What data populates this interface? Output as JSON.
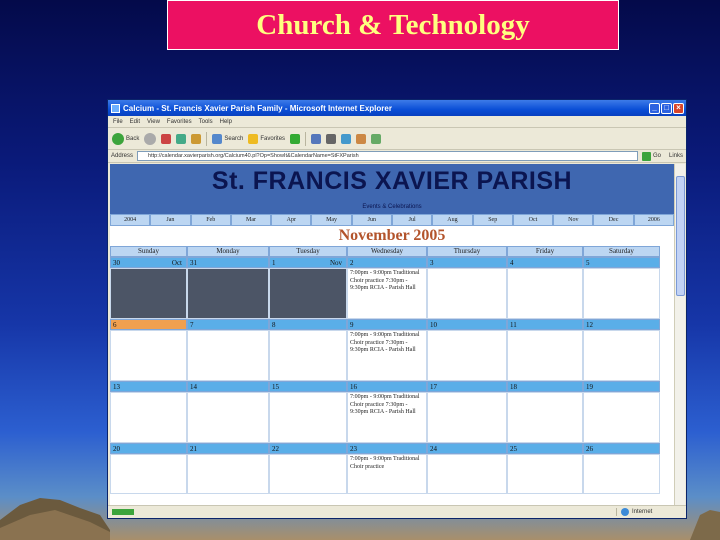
{
  "slide": {
    "title": "Church & Technology"
  },
  "window": {
    "title": "Calcium - St. Francis Xavier Parish Family - Microsoft Internet Explorer",
    "menu": [
      "File",
      "Edit",
      "View",
      "Favorites",
      "Tools",
      "Help"
    ],
    "toolbar": {
      "back": "Back",
      "search": "Search",
      "favorites": "Favorites"
    },
    "address": {
      "label": "Address",
      "url": "http://calendar.xavierparish.org/Calcium40.pl?Op=ShowIt&CalendarName=StFXParish",
      "go": "Go",
      "links": "Links"
    },
    "status": {
      "zone": "Internet"
    }
  },
  "calendar": {
    "parish": "St. FRANCIS XAVIER PARISH",
    "subtitle": "Events & Celebrations",
    "months": [
      "2004",
      "Jan",
      "Feb",
      "Mar",
      "Apr",
      "May",
      "Jun",
      "Jul",
      "Aug",
      "Sep",
      "Oct",
      "Nov",
      "Dec",
      "2006"
    ],
    "month_title": "November 2005",
    "weekdays": [
      "Sunday",
      "Monday",
      "Tuesday",
      "Wednesday",
      "Thursday",
      "Friday",
      "Saturday"
    ],
    "weeks": [
      {
        "days": [
          {
            "n": "30",
            "tag": "Oct"
          },
          {
            "n": "31",
            "tag": ""
          },
          {
            "n": "1",
            "tag": "Nov"
          },
          {
            "n": "2",
            "tag": ""
          },
          {
            "n": "3",
            "tag": ""
          },
          {
            "n": "4",
            "tag": ""
          },
          {
            "n": "5",
            "tag": ""
          }
        ],
        "events": [
          "",
          "",
          "",
          "7:00pm - 9:00pm Traditional Choir practice 7:30pm - 9:30pm RCIA - Parish Hall",
          "",
          "",
          ""
        ]
      },
      {
        "days": [
          {
            "n": "6",
            "tag": ""
          },
          {
            "n": "7",
            "tag": ""
          },
          {
            "n": "8",
            "tag": ""
          },
          {
            "n": "9",
            "tag": ""
          },
          {
            "n": "10",
            "tag": ""
          },
          {
            "n": "11",
            "tag": ""
          },
          {
            "n": "12",
            "tag": ""
          }
        ],
        "events": [
          "",
          "",
          "",
          "7:00pm - 9:00pm Traditional Choir practice 7:30pm - 9:30pm RCIA - Parish Hall",
          "",
          "",
          ""
        ]
      },
      {
        "days": [
          {
            "n": "13",
            "tag": ""
          },
          {
            "n": "14",
            "tag": ""
          },
          {
            "n": "15",
            "tag": ""
          },
          {
            "n": "16",
            "tag": ""
          },
          {
            "n": "17",
            "tag": ""
          },
          {
            "n": "18",
            "tag": ""
          },
          {
            "n": "19",
            "tag": ""
          }
        ],
        "events": [
          "",
          "",
          "",
          "7:00pm - 9:00pm Traditional Choir practice 7:30pm - 9:30pm RCIA - Parish Hall",
          "",
          "",
          ""
        ]
      },
      {
        "days": [
          {
            "n": "20",
            "tag": ""
          },
          {
            "n": "21",
            "tag": ""
          },
          {
            "n": "22",
            "tag": ""
          },
          {
            "n": "23",
            "tag": ""
          },
          {
            "n": "24",
            "tag": ""
          },
          {
            "n": "25",
            "tag": ""
          },
          {
            "n": "26",
            "tag": ""
          }
        ],
        "events": [
          "",
          "",
          "",
          "7:00pm - 9:00pm Traditional Choir practice",
          "",
          "",
          ""
        ]
      }
    ]
  }
}
